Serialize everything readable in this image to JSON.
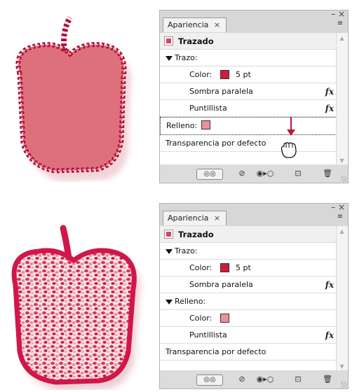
{
  "panel_top": {
    "tab_label": "Apariencia",
    "tab_close": "×",
    "window_controls": "– ×",
    "menu_icon": "≡",
    "header": "Trazado",
    "stroke_section": "Trazo:",
    "stroke_color_label": "Color:",
    "stroke_weight": "5 pt",
    "effect_1": "Sombra paralela",
    "effect_2": "Puntillista",
    "fill_label": "Relleno:",
    "transparency": "Transparencia por defecto"
  },
  "panel_bottom": {
    "tab_label": "Apariencia",
    "tab_close": "×",
    "window_controls": "– ×",
    "menu_icon": "≡",
    "header": "Trazado",
    "stroke_section": "Trazo:",
    "stroke_color_label": "Color:",
    "stroke_weight": "5 pt",
    "effect_1": "Sombra paralela",
    "fill_section": "Relleno:",
    "fill_color_label": "Color:",
    "fill_effect": "Puntillista",
    "transparency": "Transparencia por defecto"
  },
  "bottom_bar": {
    "toggle_icon": "visibility-toggle-icon",
    "clear_icon": "clear-appearance-icon",
    "reduce_icon": "reduce-to-basic-icon",
    "duplicate_icon": "duplicate-item-icon",
    "delete_icon": "trash-icon"
  },
  "colors": {
    "stroke": "#d21a3a",
    "fill": "#f0909c",
    "arrow": "#c0143c"
  }
}
